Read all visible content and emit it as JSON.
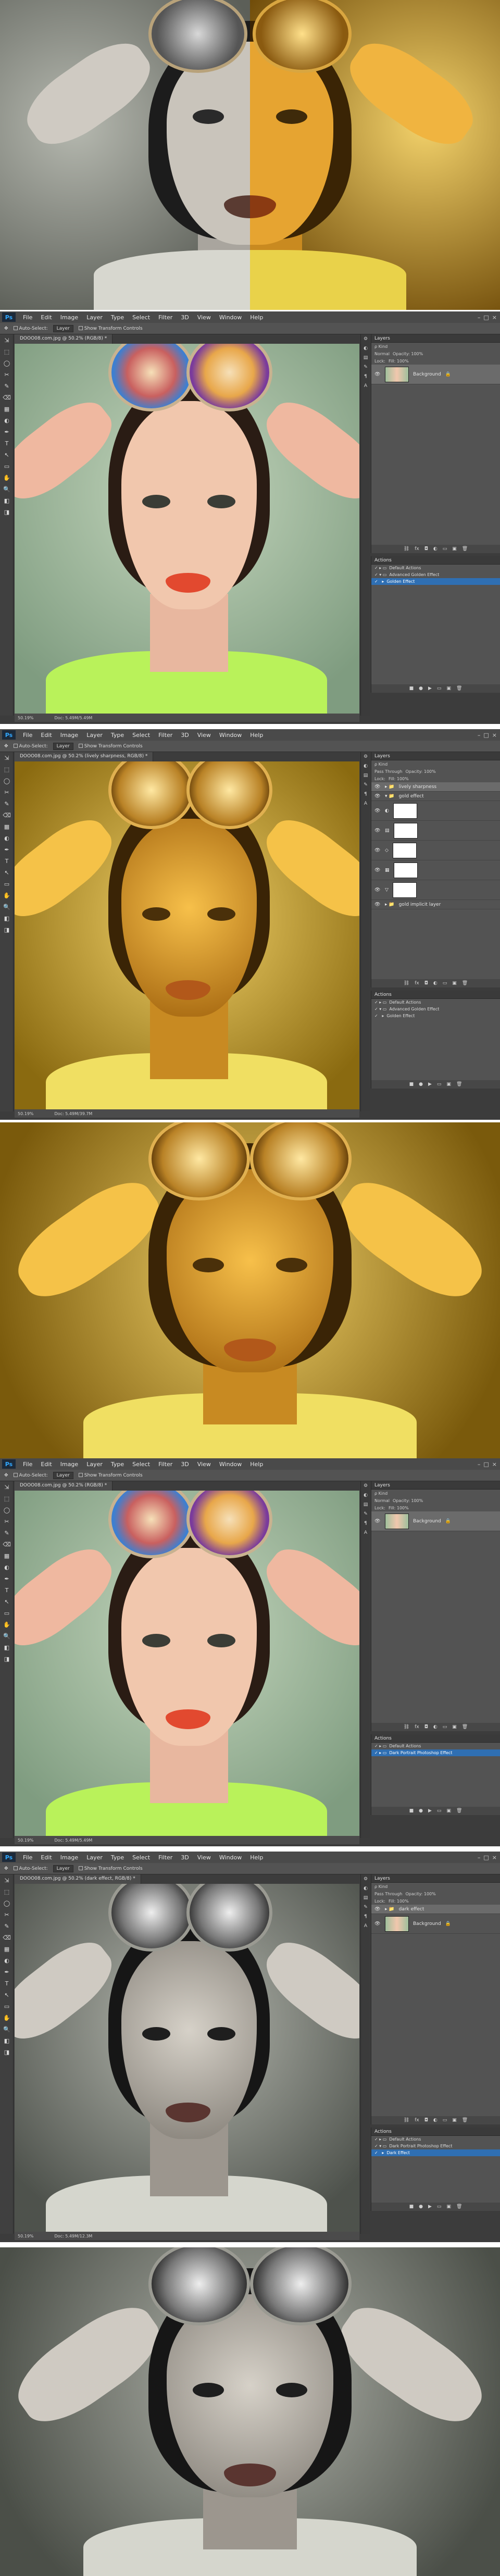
{
  "menu": {
    "logo": "Ps",
    "items": [
      "File",
      "Edit",
      "Image",
      "Layer",
      "Type",
      "Select",
      "Filter",
      "3D",
      "View",
      "Window",
      "Help"
    ],
    "window_controls": [
      "–",
      "□",
      "×"
    ]
  },
  "options_bar": {
    "auto_select": "Auto-Select:",
    "auto_select_value": "Layer",
    "show_transform": "Show Transform Controls"
  },
  "tools": [
    "⇲",
    "⬚",
    "◯",
    "✂",
    "✎",
    "⌫",
    "▦",
    "◐",
    "✒",
    "T",
    "↖",
    "▭",
    "✋",
    "🔍",
    "◧",
    "◨"
  ],
  "panel_icons": [
    "⚙",
    "◐",
    "▤",
    "✎",
    "¶",
    "A",
    "⊞"
  ],
  "screens": {
    "s1": {
      "doc_tab": "DOOO08.com.jpg @ 50.2% (RGB/8) *",
      "status_zoom": "50.19%",
      "status_doc": "Doc: 5.49M/5.49M",
      "layers_title": "Layers",
      "layers_rows": [
        "ρ Kind",
        "Normal",
        "Lock:"
      ],
      "opacity": "Opacity: 100%",
      "fill": "Fill: 100%",
      "layers": [
        {
          "name": "Background",
          "lock": "🔒"
        }
      ],
      "actions_title": "Actions",
      "actions": [
        {
          "name": "Default Actions",
          "selected": false
        },
        {
          "name": "Advanced Golden Effect",
          "selected": false
        },
        {
          "name": "Golden Effect",
          "selected": true
        }
      ]
    },
    "s2": {
      "doc_tab": "DOOO08.com.jpg @ 50.2% (lively sharpness, RGB/8) *",
      "status_zoom": "50.19%",
      "status_doc": "Doc: 5.49M/39.7M",
      "layers_title": "Layers",
      "layers_rows": [
        "ρ Kind",
        "Pass Through",
        "Lock:"
      ],
      "opacity": "Opacity: 100%",
      "fill": "Fill: 100%",
      "layers": [
        {
          "name": "lively sharpness",
          "kind": "group"
        },
        {
          "name": "gold effect",
          "kind": "group"
        },
        {
          "name": "",
          "kind": "adj"
        },
        {
          "name": "",
          "kind": "adj"
        },
        {
          "name": "",
          "kind": "adj"
        },
        {
          "name": "",
          "kind": "adj"
        },
        {
          "name": "",
          "kind": "adj"
        },
        {
          "name": "gold implicit layer",
          "kind": "group"
        }
      ],
      "actions_title": "Actions",
      "actions": [
        {
          "name": "Default Actions",
          "selected": false
        },
        {
          "name": "Advanced Golden Effect",
          "selected": false
        },
        {
          "name": "Golden Effect",
          "selected": false
        }
      ]
    },
    "s3": {
      "doc_tab": "DOOO08.com.jpg @ 50.2% (RGB/8) *",
      "status_zoom": "50.19%",
      "status_doc": "Doc: 5.49M/5.49M",
      "layers_title": "Layers",
      "layers_rows": [
        "ρ Kind",
        "Normal",
        "Lock:"
      ],
      "opacity": "Opacity: 100%",
      "fill": "Fill: 100%",
      "layers": [
        {
          "name": "Background",
          "lock": "🔒"
        }
      ],
      "actions_title": "Actions",
      "actions": [
        {
          "name": "Default Actions",
          "selected": false
        },
        {
          "name": "Dark Portrait Photoshop Effect",
          "selected": true
        }
      ]
    },
    "s4": {
      "doc_tab": "DOOO08.com.jpg @ 50.2% (dark effect, RGB/8) *",
      "status_zoom": "50.19%",
      "status_doc": "Doc: 5.49M/12.3M",
      "layers_title": "Layers",
      "layers_rows": [
        "ρ Kind",
        "Pass Through",
        "Lock:"
      ],
      "opacity": "Opacity: 100%",
      "fill": "Fill: 100%",
      "layers": [
        {
          "name": "dark effect",
          "kind": "group"
        },
        {
          "name": "Background",
          "lock": "🔒"
        }
      ],
      "actions_title": "Actions",
      "actions": [
        {
          "name": "Default Actions",
          "selected": false
        },
        {
          "name": "Dark Portrait Photoshop Effect",
          "selected": false
        },
        {
          "name": "Dark Effect",
          "selected": true
        }
      ]
    }
  },
  "colors": {
    "gold_light": "#f2c24a",
    "gold_dark": "#8a5a10",
    "mint_bg": "#9fbf9c",
    "gray_bg": "#7d8079",
    "lips_red": "#e2492f",
    "collar_green": "#b9f25a"
  }
}
